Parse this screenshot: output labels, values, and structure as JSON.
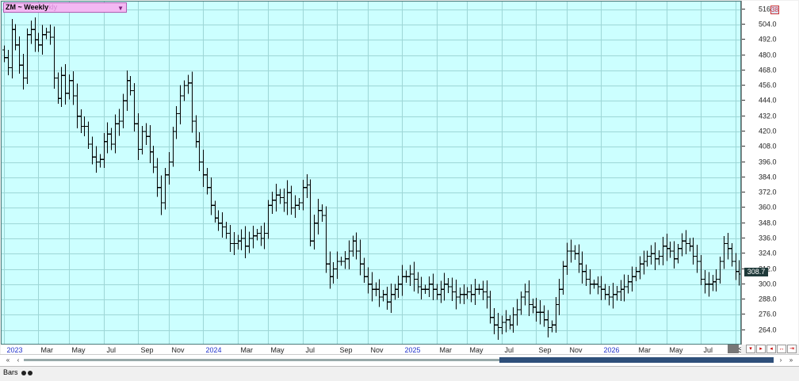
{
  "header": {
    "symbol": "ZM ~ Weekly",
    "ghost_text": "kly"
  },
  "last_price": "308.7",
  "corner_badge": "38",
  "footer": {
    "tab_label": "Bars"
  },
  "colors": {
    "plot_bg": "#ccffff",
    "grid": "#9dd6d6",
    "bars": "#000000",
    "year_label": "#2233cc",
    "month_label": "#222222"
  },
  "icons": [
    "dropdown-caret-icon",
    "scroll-left-icon",
    "scroll-right-icon",
    "nav-buttons-icon"
  ],
  "chart_data": {
    "type": "ohlc",
    "title": "ZM ~ Weekly",
    "ylim": [
      252,
      522
    ],
    "y_ticks": [
      264.0,
      276.0,
      288.0,
      300.0,
      312.0,
      324.0,
      336.0,
      348.0,
      360.0,
      372.0,
      384.0,
      396.0,
      408.0,
      420.0,
      432.0,
      444.0,
      456.0,
      468.0,
      480.0,
      492.0,
      504.0,
      516.0
    ],
    "x_ticks": [
      {
        "label": "2023",
        "year": true
      },
      {
        "label": "Mar"
      },
      {
        "label": "May"
      },
      {
        "label": "Jul"
      },
      {
        "label": "Sep"
      },
      {
        "label": "Nov"
      },
      {
        "label": "2024",
        "year": true
      },
      {
        "label": "Mar"
      },
      {
        "label": "May"
      },
      {
        "label": "Jul"
      },
      {
        "label": "Sep"
      },
      {
        "label": "Nov"
      },
      {
        "label": "2025",
        "year": true
      },
      {
        "label": "Mar"
      },
      {
        "label": "May"
      },
      {
        "label": "Jul"
      },
      {
        "label": "Sep"
      },
      {
        "label": "Nov"
      },
      {
        "label": "2026",
        "year": true
      },
      {
        "label": "Mar"
      },
      {
        "label": "May"
      },
      {
        "label": "Jul"
      },
      {
        "label": "S"
      }
    ],
    "x_tick_index": [
      0,
      9,
      17,
      26,
      35,
      43,
      52,
      61,
      69,
      78,
      87,
      95,
      104,
      113,
      121,
      130,
      139,
      147,
      156,
      165,
      173,
      182,
      191
    ],
    "closes": [
      478,
      470,
      500,
      488,
      472,
      462,
      496,
      500,
      492,
      488,
      496,
      498,
      494,
      462,
      446,
      464,
      450,
      460,
      448,
      432,
      424,
      424,
      410,
      400,
      396,
      398,
      412,
      418,
      410,
      426,
      428,
      444,
      460,
      452,
      426,
      406,
      420,
      416,
      404,
      392,
      376,
      364,
      386,
      396,
      420,
      434,
      448,
      456,
      458,
      428,
      412,
      396,
      386,
      376,
      362,
      352,
      348,
      345,
      340,
      332,
      332,
      334,
      336,
      330,
      336,
      338,
      340,
      336,
      340,
      362,
      366,
      370,
      368,
      364,
      372,
      360,
      362,
      364,
      376,
      378,
      334,
      348,
      358,
      354,
      316,
      306,
      312,
      318,
      318,
      320,
      326,
      334,
      326,
      316,
      306,
      300,
      296,
      296,
      290,
      292,
      286,
      292,
      296,
      300,
      306,
      306,
      308,
      304,
      298,
      296,
      296,
      300,
      296,
      292,
      296,
      300,
      298,
      294,
      290,
      292,
      292,
      294,
      292,
      296,
      296,
      294,
      290,
      274,
      268,
      266,
      270,
      272,
      268,
      276,
      280,
      290,
      294,
      284,
      282,
      278,
      278,
      272,
      266,
      268,
      284,
      296,
      314,
      326,
      326,
      324,
      316,
      310,
      304,
      300,
      300,
      298,
      296,
      292,
      290,
      292,
      294,
      296,
      298,
      302,
      306,
      310,
      316,
      318,
      322,
      324,
      320,
      322,
      330,
      328,
      326,
      320,
      328,
      334,
      332,
      330,
      322,
      318,
      304,
      300,
      300,
      302,
      304,
      318,
      332,
      328,
      318,
      310,
      308,
      308.7
    ]
  }
}
